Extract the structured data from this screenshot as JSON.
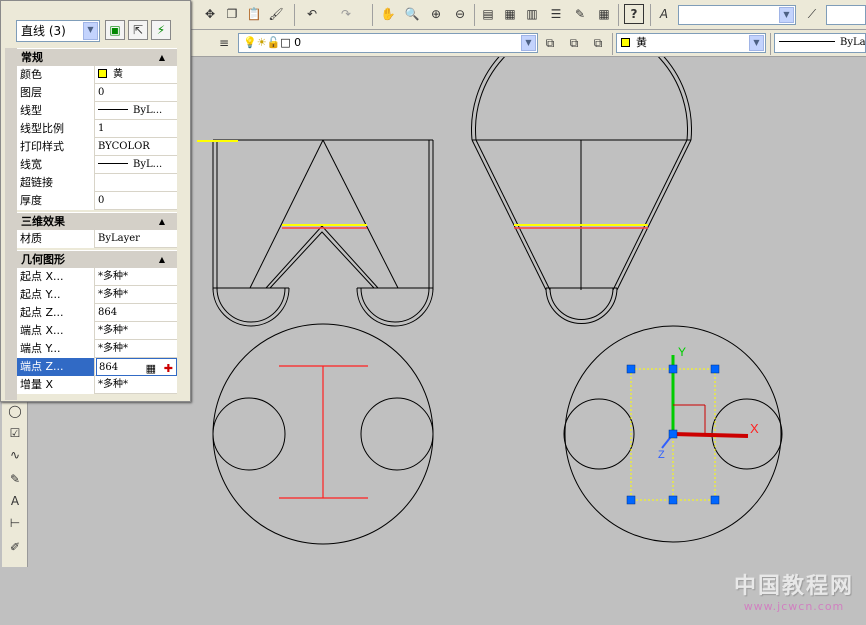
{
  "toolbar1": {
    "icons": [
      "pan-icon",
      "copy-icon",
      "paste-icon",
      "match-properties-icon",
      "brush-icon",
      "undo-icon",
      "redo-icon",
      "realtime-pan-icon",
      "zoom-realtime-icon",
      "zoom-window-icon",
      "zoom-previous-icon",
      "properties-icon",
      "design-center-icon",
      "tool-palettes-icon",
      "sheet-set-icon",
      "calculator-icon",
      "help-icon"
    ],
    "style_combo_value": ""
  },
  "toolbar2": {
    "layer_value": "0",
    "color_value": "黄",
    "linetype_value": "ByLa"
  },
  "properties": {
    "object_type": "直线 (3)",
    "categories": [
      {
        "label": "常规",
        "rows": [
          {
            "label": "颜色",
            "value": "黄"
          },
          {
            "label": "图层",
            "value": "0"
          },
          {
            "label": "线型",
            "value": "ByL..."
          },
          {
            "label": "线型比例",
            "value": "1"
          },
          {
            "label": "打印样式",
            "value": "BYCOLOR"
          },
          {
            "label": "线宽",
            "value": "ByL..."
          },
          {
            "label": "超链接",
            "value": ""
          },
          {
            "label": "厚度",
            "value": "0"
          }
        ]
      },
      {
        "label": "三维效果",
        "rows": [
          {
            "label": "材质",
            "value": "ByLayer"
          }
        ]
      },
      {
        "label": "几何图形",
        "rows": [
          {
            "label": "起点 X...",
            "value": "*多种*"
          },
          {
            "label": "起点 Y...",
            "value": "*多种*"
          },
          {
            "label": "起点 Z...",
            "value": "864"
          },
          {
            "label": "端点 X...",
            "value": "*多种*"
          },
          {
            "label": "端点 Y...",
            "value": "*多种*"
          },
          {
            "label": "端点 Z...",
            "value": "864"
          },
          {
            "label": "增量 X",
            "value": "*多种*"
          }
        ]
      }
    ]
  },
  "drawing": {
    "ucs_y_label": "Y",
    "ucs_z_label": "Z",
    "ucs_x_label": "X"
  },
  "watermark": {
    "text": "中国教程网",
    "url": "www.jcwcn.com"
  },
  "colors": {
    "yellow": "#ffff00",
    "red": "#ff0000",
    "grip": "#0066ff",
    "background": "#c0c0c0"
  }
}
